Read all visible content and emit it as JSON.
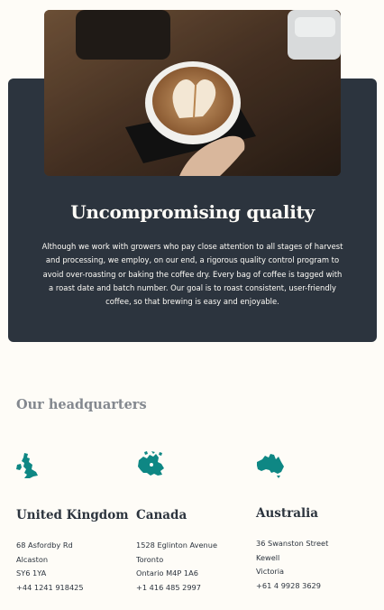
{
  "quality": {
    "title": "Uncompromising quality",
    "body": "Although we work with growers who pay close attention to all stages of harvest and processing, we employ, on our end, a rigorous quality control program to avoid over-roasting or baking the coffee dry. Every bag of coffee is tagged with a roast date and batch number. Our goal is to roast consistent, user-friendly coffee, so that brewing is easy and enjoyable."
  },
  "headquarters": {
    "heading": "Our headquarters",
    "accent_color": "#0e8784",
    "locations": [
      {
        "country": "United Kingdom",
        "icon": "uk-map-icon",
        "lines": [
          "68 Asfordby Rd",
          "Alcaston",
          "SY6 1YA",
          "+44 1241 918425"
        ]
      },
      {
        "country": "Canada",
        "icon": "canada-map-icon",
        "lines": [
          "1528 Eglinton Avenue",
          "Toronto",
          "Ontario M4P 1A6",
          "+1 416 485 2997"
        ]
      },
      {
        "country": "Australia",
        "icon": "australia-map-icon",
        "lines": [
          "36 Swanston Street",
          "Kewell",
          "Victoria",
          "+61 4 9928 3629"
        ]
      }
    ]
  }
}
